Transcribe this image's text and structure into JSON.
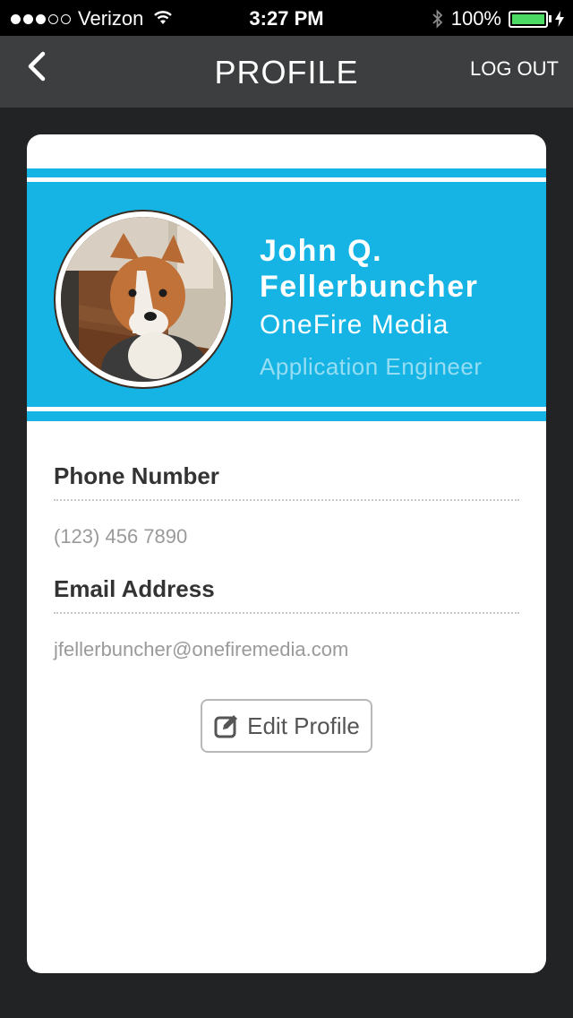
{
  "status_bar": {
    "carrier": "Verizon",
    "time": "3:27 PM",
    "battery": "100%",
    "signal_bars_filled": 3,
    "signal_bars_total": 5
  },
  "nav": {
    "title": "PROFILE",
    "logout_label": "LOG OUT",
    "back_icon": "chevron-left-icon"
  },
  "profile": {
    "name": "John Q. Fellerbuncher",
    "company": "OneFire Media",
    "title": "Application Engineer",
    "avatar_icon": "dog-photo"
  },
  "fields": {
    "phone_label": "Phone Number",
    "phone_value": "(123) 456 7890",
    "email_label": "Email Address",
    "email_value": "jfellerbuncher@onefiremedia.com"
  },
  "actions": {
    "edit_label": "Edit Profile",
    "edit_icon": "edit-icon"
  },
  "colors": {
    "accent": "#16b4e4",
    "background": "#222324",
    "nav": "#3d3e3f"
  }
}
